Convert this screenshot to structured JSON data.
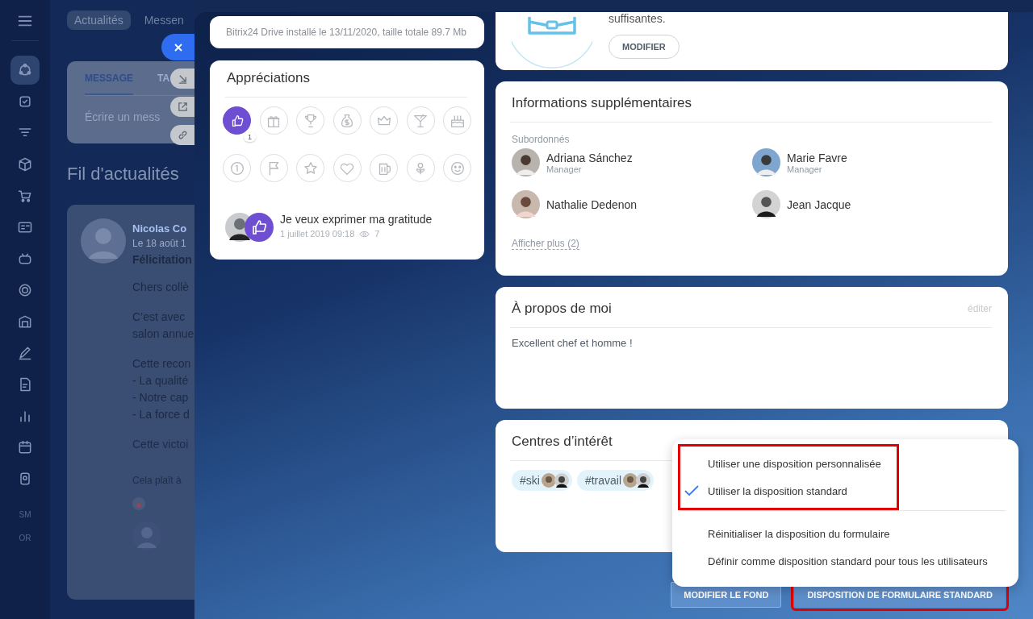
{
  "sidebar": {
    "items": [
      {
        "selected": true
      },
      {
        "selected": false
      },
      {
        "selected": false
      },
      {
        "selected": false
      },
      {
        "selected": false
      },
      {
        "selected": false
      },
      {
        "selected": false
      },
      {
        "selected": false
      },
      {
        "selected": false
      },
      {
        "selected": false
      },
      {
        "selected": false
      },
      {
        "selected": false
      },
      {
        "selected": false
      },
      {
        "selected": false
      }
    ],
    "labels": [
      "SM",
      "OR"
    ]
  },
  "feed": {
    "tabs": [
      {
        "label": "Actualités",
        "selected": true
      },
      {
        "label": "Messen",
        "selected": false
      }
    ],
    "composer": {
      "tabs": [
        {
          "label": "MESSAGE",
          "selected": true
        },
        {
          "label": "TA",
          "selected": false
        }
      ],
      "placeholder": "Écrire un mess"
    },
    "title": "Fil d'actualités",
    "post": {
      "author": "Nicolas Co",
      "date": "Le 18 août 1",
      "subject": "Félicitation",
      "paragraphs": [
        [
          "Chers collè"
        ],
        [
          "C’est avec",
          "salon annue"
        ],
        [
          "Cette recon",
          "- La qualité",
          "- Notre cap",
          "- La force d"
        ]
      ],
      "faded": "Cette victoi",
      "likes": "Cela plaît à"
    }
  },
  "drive_note": "Bitrix24 Drive installé le 13/11/2020, taille totale 89.7 Mb",
  "appreciations": {
    "title": "Appréciations",
    "badges": [
      {
        "selected": true,
        "count": "1"
      },
      {
        "selected": false
      },
      {
        "selected": false
      },
      {
        "selected": false
      },
      {
        "selected": false
      },
      {
        "selected": false
      },
      {
        "selected": false
      },
      {
        "selected": false
      },
      {
        "selected": false
      },
      {
        "selected": false
      },
      {
        "selected": false
      },
      {
        "selected": false
      },
      {
        "selected": false
      },
      {
        "selected": false
      }
    ],
    "entry": {
      "title": "Je veux exprimer ma gratitude",
      "date": "1 juillet 2019 09:18",
      "views": "7"
    }
  },
  "top_card": {
    "text": "suffisantes.",
    "button": "MODIFIER"
  },
  "extra_info": {
    "title": "Informations supplémentaires",
    "label": "Subordonnés",
    "people": [
      {
        "name": "Adriana Sánchez",
        "role": "Manager"
      },
      {
        "name": "Marie Favre",
        "role": "Manager"
      },
      {
        "name": "Nathalie Dedenon"
      },
      {
        "name": "Jean Jacque"
      }
    ],
    "more": "Afficher plus (2)"
  },
  "about": {
    "title": "À propos de moi",
    "edit": "éditer",
    "text": "Excellent chef et homme !"
  },
  "interests": {
    "title": "Centres d’intérêt",
    "tags": [
      "#ski",
      "#travail"
    ]
  },
  "menu": {
    "sections": [
      {
        "highlighted": true,
        "items": [
          {
            "label": "Utiliser une disposition personnalisée",
            "checked": false
          },
          {
            "label": "Utiliser la disposition standard",
            "checked": true
          }
        ]
      },
      {
        "highlighted": false,
        "items": [
          {
            "label": "Réinitialiser la disposition du formulaire",
            "checked": false
          },
          {
            "label": "Définir comme disposition standard pour tous les utilisateurs",
            "checked": false
          }
        ]
      }
    ]
  },
  "buttons": [
    {
      "label": "MODIFIER LE FOND",
      "highlighted": false
    },
    {
      "label": "DISPOSITION DE FORMULAIRE STANDARD",
      "highlighted": true
    }
  ]
}
